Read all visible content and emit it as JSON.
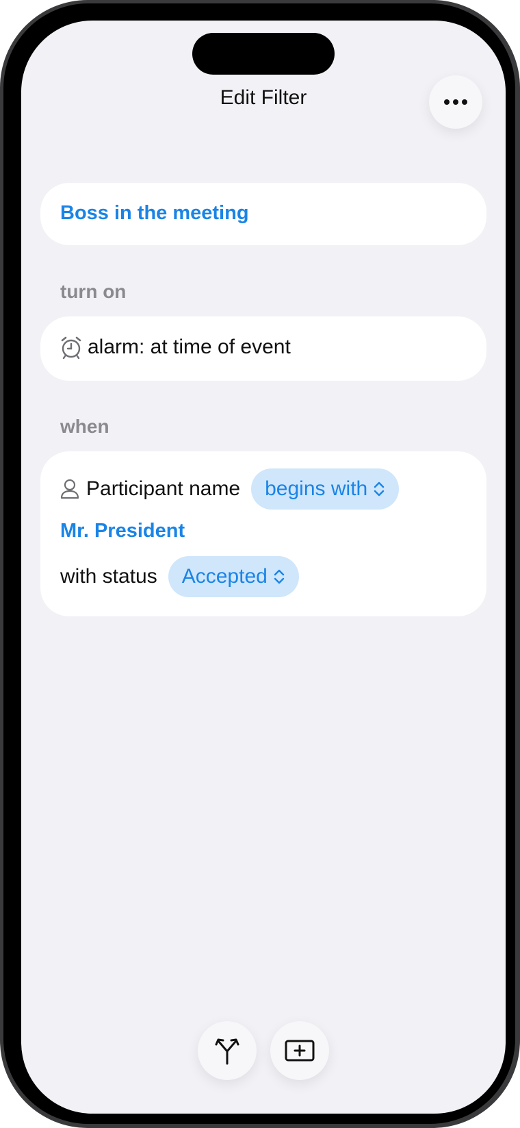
{
  "header": {
    "title": "Edit Filter",
    "more_icon": "ellipsis-icon"
  },
  "filter": {
    "name": "Boss in the meeting"
  },
  "turn_on": {
    "label": "turn on",
    "action_icon": "alarm-clock-icon",
    "action_text": "alarm: at time of event"
  },
  "when": {
    "label": "when",
    "field_icon": "person-icon",
    "field_label": "Participant name",
    "operator": "begins with",
    "value": "Mr. President",
    "status_label": "with status",
    "status_value": "Accepted"
  },
  "toolbar": {
    "branch_icon": "branch-arrows-icon",
    "add_icon": "add-box-icon"
  },
  "colors": {
    "accent": "#1a84e6",
    "pill_bg": "#cfe6fb",
    "screen_bg": "#f1f1f6",
    "section_label": "#8a8a8e"
  }
}
